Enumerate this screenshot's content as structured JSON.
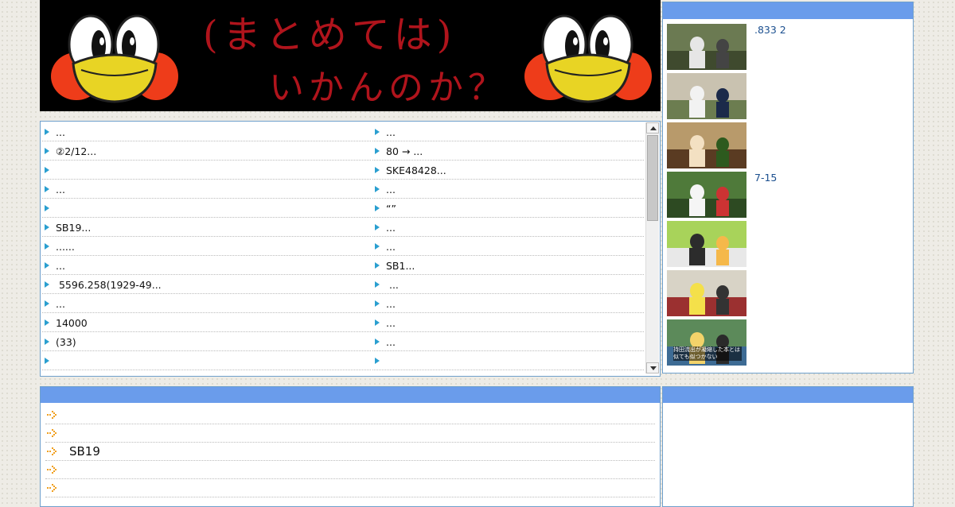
{
  "banner": {
    "title_line1": "(まとめては)",
    "title_line2": "いかんのか？"
  },
  "link_list": {
    "left": [
      "...",
      "②2/12...",
      "",
      "...",
      "",
      "SB19...",
      "......",
      "...",
      " 5596.258(1929-49...",
      "...",
      "14000",
      "(33)",
      ""
    ],
    "right": [
      "...",
      "80 → ...",
      "SKE48428...",
      "...",
      "“”",
      "...",
      "...",
      "SB1...",
      " ...",
      "...",
      "...",
      "...",
      ""
    ]
  },
  "sidebar": {
    "items": [
      {
        "caption": ".833 2",
        "thumb": "baseball-batting-photo"
      },
      {
        "caption": "",
        "thumb": "players-field-photo"
      },
      {
        "caption": "",
        "thumb": "tv-interview-photo"
      },
      {
        "caption": "7-15",
        "thumb": "player-throwing-photo"
      },
      {
        "caption": "",
        "thumb": "tv-show-screenshot"
      },
      {
        "caption": "",
        "thumb": "tv-show-screenshot"
      },
      {
        "caption": "",
        "thumb": "tv-show-screenshot"
      }
    ],
    "thumb_overlay_text": "持田流出が凝縮した本とは似ても似つかない"
  },
  "articles": {
    "items": [
      "",
      "",
      "SB19",
      "",
      ""
    ]
  },
  "colors": {
    "header_blue": "#6a9ceb",
    "border_blue": "#6fa0cc",
    "link_caption": "#1b4f8f",
    "triangle": "#2a9fd0",
    "banner_text": "#b0141c"
  }
}
